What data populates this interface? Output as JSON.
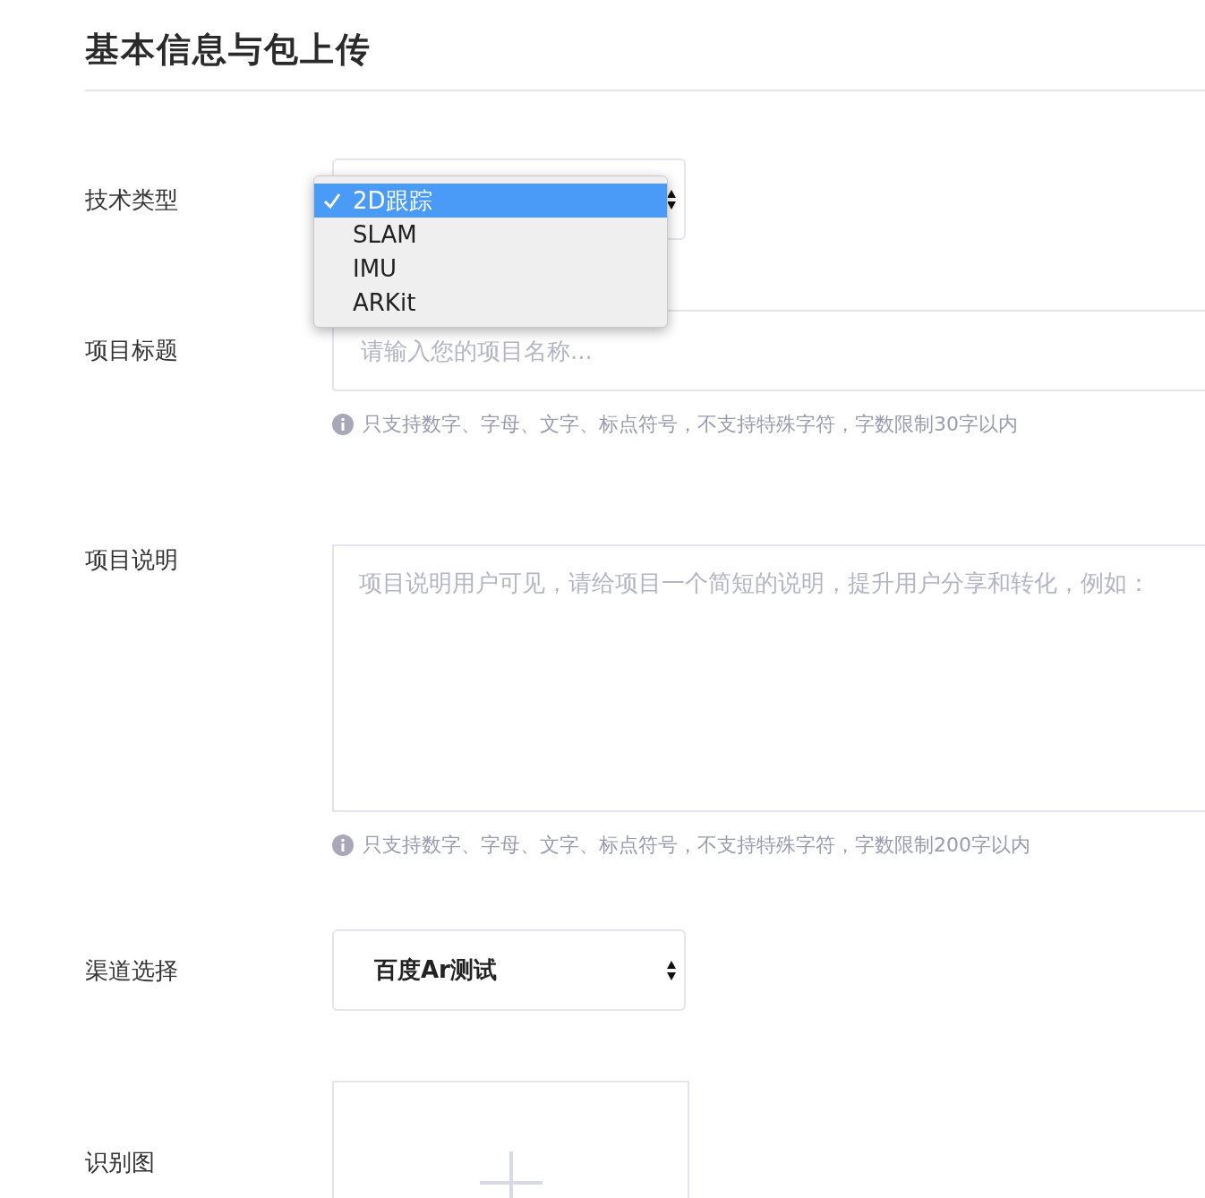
{
  "title": "基本信息与包上传",
  "fields": [
    {
      "kind": "select",
      "label": "技术类型",
      "menu": [
        {
          "label": "2D跟踪",
          "selected": true
        },
        {
          "label": "SLAM",
          "selected": false
        },
        {
          "label": "IMU",
          "selected": false
        },
        {
          "label": "ARKit",
          "selected": false
        }
      ]
    },
    {
      "kind": "input",
      "label": "项目标题",
      "placeholder": "请输入您的项目名称...",
      "hint": "只支持数字、字母、文字、标点符号，不支持特殊字符，字数限制30字以内"
    },
    {
      "kind": "textarea",
      "label": "项目说明",
      "placeholder": "项目说明用户可见，请给项目一个简短的说明，提升用户分享和转化，例如：",
      "hint": "只支持数字、字母、文字、标点符号，不支持特殊字符，字数限制200字以内"
    },
    {
      "kind": "select",
      "label": "渠道选择",
      "value": "百度Ar测试"
    },
    {
      "kind": "upload",
      "label": "识别图"
    }
  ]
}
